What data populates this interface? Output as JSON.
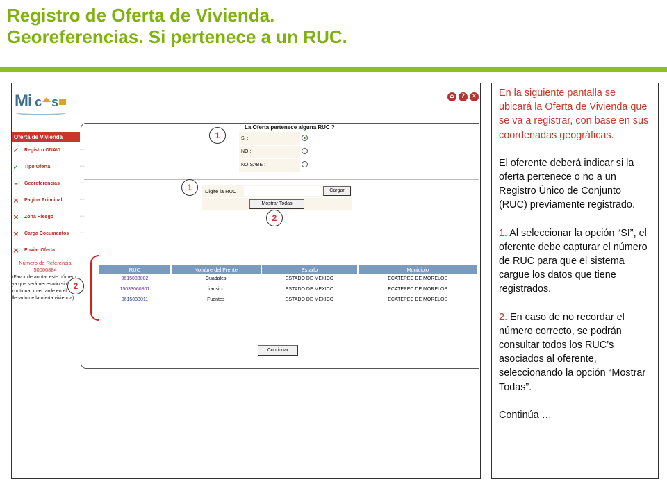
{
  "slide": {
    "title_line1": "Registro de Oferta de Vivienda.",
    "title_line2": "Georeferencias. Si pertenece a un RUC.",
    "accent_color": "#7fb20f"
  },
  "app": {
    "logo_mi": "Mi",
    "logo_c": "c",
    "logo_s": "s",
    "window_icons": [
      "home-icon",
      "help-icon",
      "close-icon"
    ],
    "window_glyphs": [
      "⌂",
      "?",
      "✕"
    ]
  },
  "sidebar": {
    "header": "Oferta de Vivienda",
    "items": [
      {
        "label": "Registro ONAVI",
        "status": "done",
        "glyph": "✓"
      },
      {
        "label": "Tipo Oferta",
        "status": "done",
        "glyph": "✓"
      },
      {
        "label": "Georeferencias",
        "status": "current",
        "glyph": "–"
      },
      {
        "label": "Pagina Principal",
        "status": "pending",
        "glyph": "×"
      },
      {
        "label": "Zona Riesgo",
        "status": "pending",
        "glyph": "×"
      },
      {
        "label": "Carga Documentos",
        "status": "pending",
        "glyph": "×"
      },
      {
        "label": "Enviar Oferta",
        "status": "pending",
        "glyph": "×"
      }
    ],
    "dots": "·····",
    "reference_label": "Número de Referencia",
    "reference_number": "50000884",
    "note": "(Favor de anotar este número ya que será necesario si desea continuar mas tarde en el llenado de la oferta vivienda)"
  },
  "question": {
    "title": "La Oferta pertenece alguna RUC ?",
    "options": [
      {
        "label": "SI :",
        "selected": true
      },
      {
        "label": "NO :",
        "selected": false
      },
      {
        "label": "NO SABE :",
        "selected": false
      }
    ]
  },
  "ruc_search": {
    "label": "Digite la RUC",
    "input_value": "",
    "load_button": "Cargar",
    "show_all_button": "Mostrar Todas"
  },
  "callouts": {
    "one": "1",
    "two": "2"
  },
  "ruc_table": {
    "columns": [
      "RUC",
      "Nombre del Frente",
      "Estado",
      "Municipio"
    ],
    "rows": [
      [
        "0615033002",
        "Cuadales",
        "ESTADO DE MEXICO",
        "ECATEPEC DE MORELOS"
      ],
      [
        "15033060801",
        "fransico",
        "ESTADO DE MEXICO",
        "ECATEPEC DE MORELOS"
      ],
      [
        "0615033011",
        "Fuentes",
        "ESTADO DE MEXICO",
        "ECATEPEC DE MORELOS"
      ]
    ]
  },
  "continue_button": "Continuar",
  "explanation": {
    "intro": "En la siguiente pantalla se ubicará la Oferta de Vivienda que se va a registrar, con base en sus coordenadas geográficas.",
    "para1": "El oferente deberá indicar si la oferta pertenece o no a un Registro Único de Conjunto (RUC) previamente registrado.",
    "step1_num": "1.",
    "step1": "Al seleccionar la opción “SI”, el oferente debe capturar el número de RUC para que el sistema cargue los datos que tiene registrados.",
    "step2_num": "2.",
    "step2": "En caso de no recordar el número correcto, se podrán consultar todos los RUC’s asociados al oferente, seleccionando la opción “Mostrar Todas”.",
    "continues": "Continúa …"
  }
}
